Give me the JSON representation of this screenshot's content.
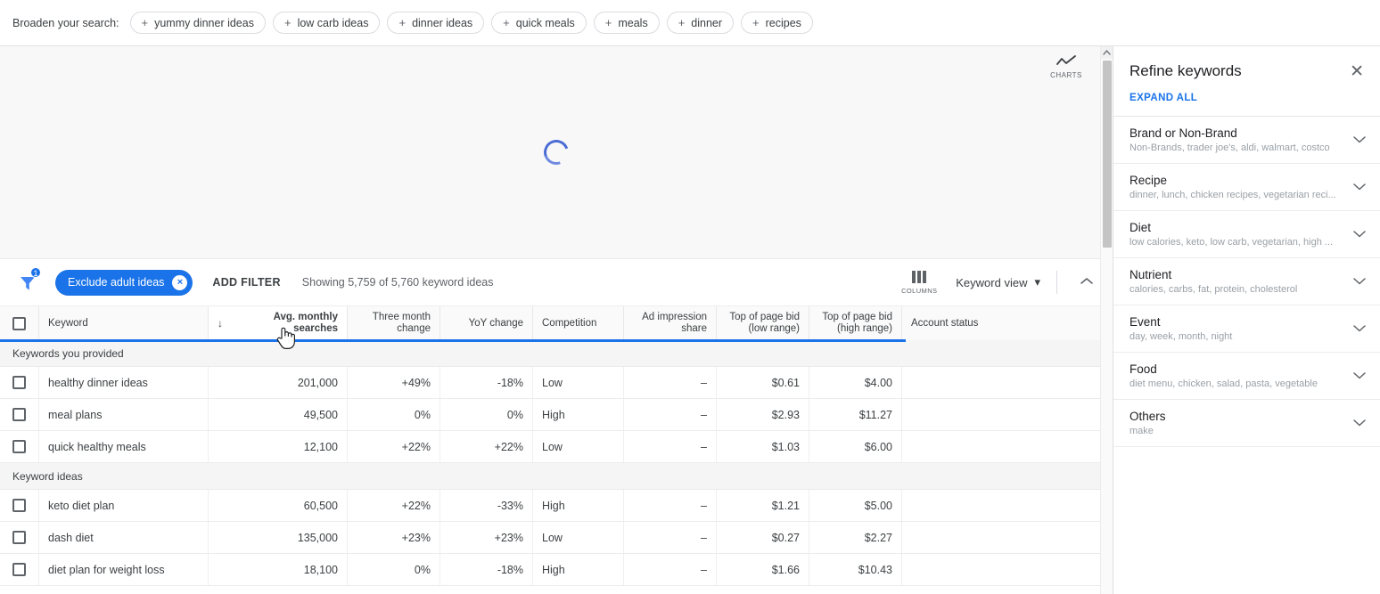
{
  "broaden": {
    "label": "Broaden your search:",
    "chips": [
      "yummy dinner ideas",
      "low carb ideas",
      "dinner ideas",
      "quick meals",
      "meals",
      "dinner",
      "recipes"
    ],
    "plus": "+"
  },
  "chart_area": {
    "charts_button_label": "CHARTS",
    "loading": true
  },
  "toolbar": {
    "filter_badge_count": "1",
    "filter_chip_label": "Exclude adult ideas",
    "filter_chip_remove": "×",
    "add_filter_label": "ADD FILTER",
    "showing_text": "Showing 5,759 of 5,760 keyword ideas",
    "columns_label": "COLUMNS",
    "keyword_view_label": "Keyword view",
    "keyword_view_caret": "▾"
  },
  "table": {
    "sort_arrow": "↓",
    "columns": [
      {
        "key": "checkbox",
        "label": ""
      },
      {
        "key": "keyword",
        "label": "Keyword"
      },
      {
        "key": "avg",
        "label": "Avg. monthly searches"
      },
      {
        "key": "three",
        "label": "Three month change"
      },
      {
        "key": "yoy",
        "label": "YoY change"
      },
      {
        "key": "comp",
        "label": "Competition"
      },
      {
        "key": "ais",
        "label": "Ad impression share"
      },
      {
        "key": "bidlow",
        "label": "Top of page bid (low range)"
      },
      {
        "key": "bidhigh",
        "label": "Top of page bid (high range)"
      },
      {
        "key": "acct",
        "label": "Account status"
      }
    ],
    "col_labels": {
      "keyword": "Keyword",
      "avg": "Avg. monthly searches",
      "three_line1": "Three month",
      "three_line2": "change",
      "yoy": "YoY change",
      "comp": "Competition",
      "ais_line1": "Ad impression",
      "ais_line2": "share",
      "bidlow_line1": "Top of page bid",
      "bidlow_line2": "(low range)",
      "bidhigh_line1": "Top of page bid",
      "bidhigh_line2": "(high range)",
      "acct": "Account status"
    },
    "groups": [
      {
        "title": "Keywords you provided",
        "rows": [
          {
            "keyword": "healthy dinner ideas",
            "avg": "201,000",
            "three": "+49%",
            "yoy": "-18%",
            "comp": "Low",
            "ais": "–",
            "bidlow": "$0.61",
            "bidhigh": "$4.00",
            "acct": ""
          },
          {
            "keyword": "meal plans",
            "avg": "49,500",
            "three": "0%",
            "yoy": "0%",
            "comp": "High",
            "ais": "–",
            "bidlow": "$2.93",
            "bidhigh": "$11.27",
            "acct": ""
          },
          {
            "keyword": "quick healthy meals",
            "avg": "12,100",
            "three": "+22%",
            "yoy": "+22%",
            "comp": "Low",
            "ais": "–",
            "bidlow": "$1.03",
            "bidhigh": "$6.00",
            "acct": ""
          }
        ]
      },
      {
        "title": "Keyword ideas",
        "rows": [
          {
            "keyword": "keto diet plan",
            "avg": "60,500",
            "three": "+22%",
            "yoy": "-33%",
            "comp": "High",
            "ais": "–",
            "bidlow": "$1.21",
            "bidhigh": "$5.00",
            "acct": ""
          },
          {
            "keyword": "dash diet",
            "avg": "135,000",
            "three": "+23%",
            "yoy": "+23%",
            "comp": "Low",
            "ais": "–",
            "bidlow": "$0.27",
            "bidhigh": "$2.27",
            "acct": ""
          },
          {
            "keyword": "diet plan for weight loss",
            "avg": "18,100",
            "three": "0%",
            "yoy": "-18%",
            "comp": "High",
            "ais": "–",
            "bidlow": "$1.66",
            "bidhigh": "$10.43",
            "acct": ""
          }
        ]
      }
    ]
  },
  "panel": {
    "title": "Refine keywords",
    "close_glyph": "✕",
    "expand_all": "EXPAND ALL",
    "items": [
      {
        "title": "Brand or Non-Brand",
        "sub": "Non-Brands, trader joe's, aldi, walmart, costco"
      },
      {
        "title": "Recipe",
        "sub": "dinner, lunch, chicken recipes, vegetarian reci..."
      },
      {
        "title": "Diet",
        "sub": "low calories, keto, low carb, vegetarian, high ..."
      },
      {
        "title": "Nutrient",
        "sub": "calories, carbs, fat, protein, cholesterol"
      },
      {
        "title": "Event",
        "sub": "day, week, month, night"
      },
      {
        "title": "Food",
        "sub": "diet menu, chicken, salad, pasta, vegetable"
      },
      {
        "title": "Others",
        "sub": "make"
      }
    ]
  },
  "colors": {
    "accent_blue": "#1a73e8",
    "header_bg": "#fafafa",
    "group_bg": "#f5f5f5",
    "text": "#3c4043",
    "muted": "#9aa0a6"
  }
}
